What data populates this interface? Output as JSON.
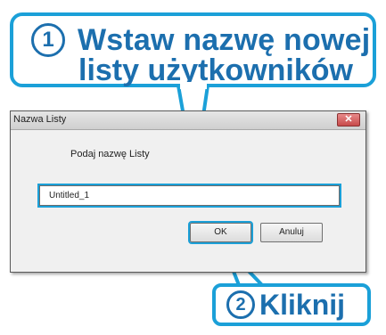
{
  "callout_top": {
    "number": "1",
    "line1": "Wstaw nazwę nowej",
    "line2": "listy użytkowników"
  },
  "dialog": {
    "title": "Nazwa Listy",
    "close_label": "✕",
    "prompt": "Podaj nazwę Listy",
    "input_value": "Untitled_1",
    "ok_label": "OK",
    "cancel_label": "Anuluj"
  },
  "callout_bottom": {
    "number": "2",
    "label": "Kliknij"
  },
  "colors": {
    "callout_border": "#1ba0d8",
    "callout_text": "#1c6fae",
    "dialog_bg": "#f0f0f0",
    "close_button": "#c74a4a"
  },
  "icons": {
    "close": "close-icon"
  }
}
